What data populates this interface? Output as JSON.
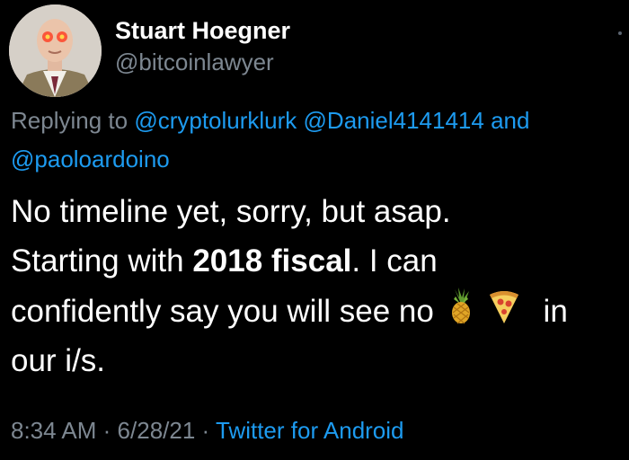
{
  "author": {
    "display_name": "Stuart Hoegner",
    "handle": "@bitcoinlawyer"
  },
  "reply": {
    "prefix": "Replying to",
    "mentions": [
      "@cryptolurklurk",
      "@Daniel4141414",
      "@paoloardoino"
    ],
    "joiner": "and"
  },
  "tweet": {
    "line1": "No timeline yet, sorry, but asap.",
    "line2_a": "Starting with ",
    "line2_bold": "2018 fiscal",
    "line2_b": ". I can",
    "line3_a": "confidently say you will see no ",
    "line3_b": "in",
    "line4": "our i/s.",
    "emojis": [
      "pineapple-emoji",
      "pizza-emoji"
    ]
  },
  "meta": {
    "time": "8:34 AM",
    "separator": "·",
    "date": "6/28/21",
    "source": "Twitter for Android"
  },
  "colors": {
    "background": "#000000",
    "text": "#ffffff",
    "secondary": "#7d8791",
    "link": "#1d9bf0"
  }
}
